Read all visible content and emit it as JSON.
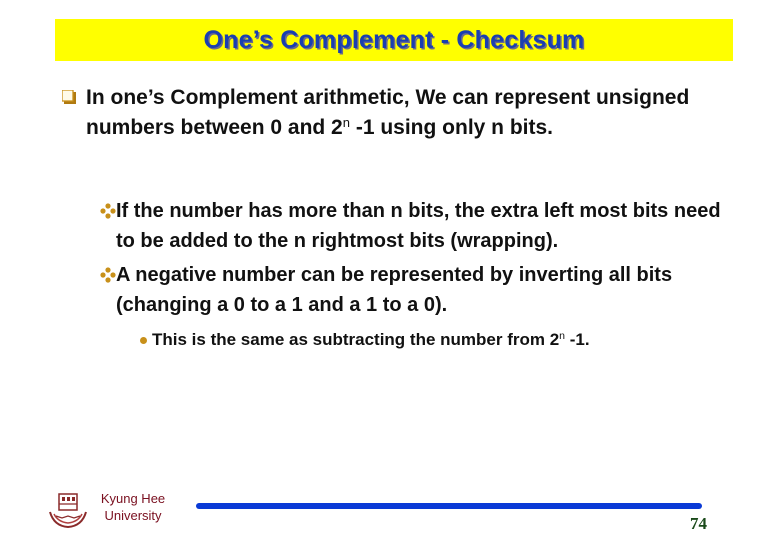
{
  "slide": {
    "title": "One’s Complement - Checksum",
    "bullets": [
      {
        "level": 1,
        "icon": "square-bullet-icon",
        "parts": [
          "In one’s Complement arithmetic, We can represent unsigned numbers between 0 and 2",
          "n",
          " -1 using only n bits."
        ]
      },
      {
        "level": 2,
        "icon": "diamond-bullet-icon",
        "text": "If the number has more than n bits, the extra left most bits need to be added to the n rightmost bits (wrapping)."
      },
      {
        "level": 2,
        "icon": "diamond-bullet-icon",
        "text": "A negative number can be represented by inverting all bits (changing a 0 to a 1 and a 1 to a 0)."
      },
      {
        "level": 3,
        "icon": "dot-bullet-icon",
        "parts": [
          "This is the same as subtracting the number from 2",
          "n",
          " -1."
        ]
      }
    ]
  },
  "footer": {
    "university_line1": "Kyung Hee",
    "university_line2": "University",
    "page_number": "74",
    "logo_icon": "university-emblem-icon"
  },
  "colors": {
    "title_bg": "#ffff00",
    "title_text": "#1a3fb0",
    "bullet_accent": "#c8901a",
    "footer_line": "#0a3ad6",
    "university_text": "#7a1020",
    "page_number": "#1a4a1a"
  }
}
